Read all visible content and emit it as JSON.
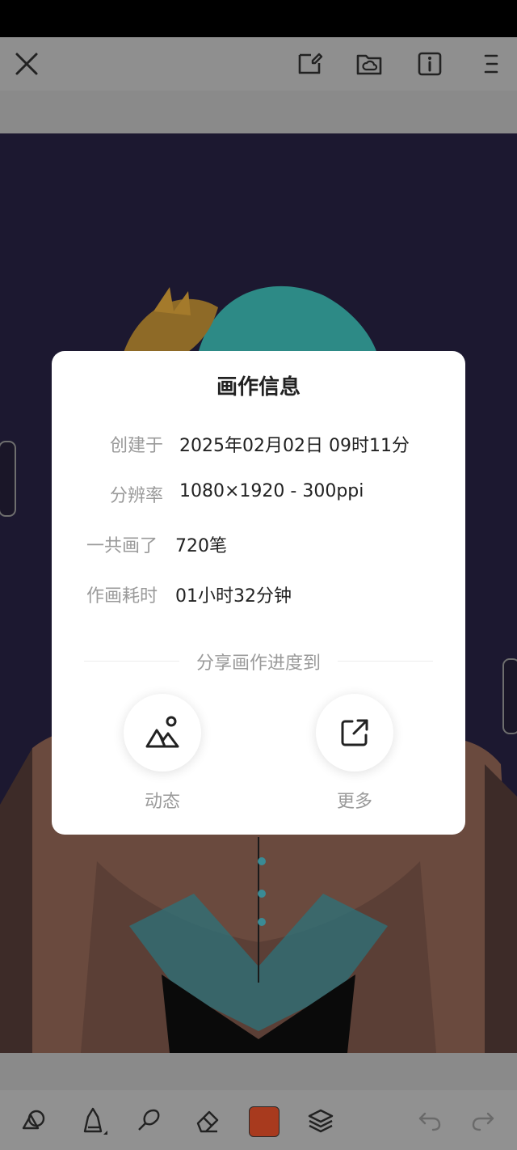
{
  "dialog": {
    "title": "画作信息",
    "rows": [
      {
        "label": "创建于",
        "value": "2025年02月02日 09时11分"
      },
      {
        "label": "分辨率",
        "value": "1080×1920 - 300ppi"
      },
      {
        "label": "一共画了",
        "value": "720笔"
      },
      {
        "label": "作画耗时",
        "value": "01小时32分钟"
      }
    ],
    "share_title": "分享画作进度到",
    "share_targets": [
      {
        "label": "动态",
        "icon": "image-mountain-icon"
      },
      {
        "label": "更多",
        "icon": "external-link-icon"
      }
    ]
  },
  "top_toolbar": {
    "icons": [
      "close-icon",
      "edit-note-icon",
      "cloud-folder-icon",
      "info-icon",
      "menu-icon"
    ]
  },
  "bottom_toolbar": {
    "icons": [
      "shapes-icon",
      "pen-icon",
      "brush-icon",
      "eraser-icon",
      "color-swatch",
      "layers-icon",
      "undo-icon",
      "redo-icon"
    ],
    "current_color": "#a83a1e"
  }
}
